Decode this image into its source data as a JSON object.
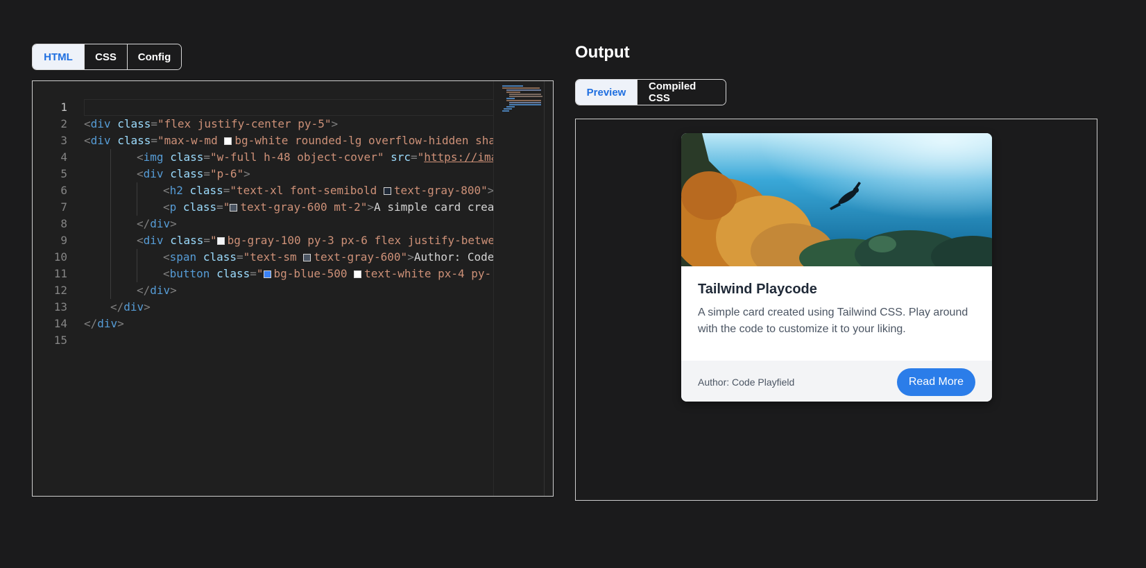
{
  "editor": {
    "tabs": [
      {
        "label": "HTML",
        "active": true
      },
      {
        "label": "CSS",
        "active": false
      },
      {
        "label": "Config",
        "active": false
      }
    ],
    "line_numbers": [
      "1",
      "2",
      "3",
      "4",
      "5",
      "6",
      "7",
      "8",
      "9",
      "10",
      "11",
      "12",
      "13",
      "14",
      "15"
    ],
    "lines": [
      {
        "indent": 0,
        "tokens": []
      },
      {
        "indent": 0,
        "tokens": [
          {
            "t": "punc",
            "v": "<"
          },
          {
            "t": "tag",
            "v": "div"
          },
          {
            "t": "text",
            "v": " "
          },
          {
            "t": "attr",
            "v": "class"
          },
          {
            "t": "punc",
            "v": "="
          },
          {
            "t": "str",
            "v": "\"flex justify-center py-5\""
          },
          {
            "t": "punc",
            "v": ">"
          }
        ]
      },
      {
        "indent": 0,
        "tokens": [
          {
            "t": "punc",
            "v": "<"
          },
          {
            "t": "tag",
            "v": "div"
          },
          {
            "t": "text",
            "v": " "
          },
          {
            "t": "attr",
            "v": "class"
          },
          {
            "t": "punc",
            "v": "="
          },
          {
            "t": "str",
            "v": "\"max-w-md "
          },
          {
            "t": "swatch",
            "v": "#ffffff"
          },
          {
            "t": "str",
            "v": "bg-white rounded-lg overflow-hidden sha"
          }
        ]
      },
      {
        "indent": 2,
        "tokens": [
          {
            "t": "punc",
            "v": "<"
          },
          {
            "t": "tag",
            "v": "img"
          },
          {
            "t": "text",
            "v": " "
          },
          {
            "t": "attr",
            "v": "class"
          },
          {
            "t": "punc",
            "v": "="
          },
          {
            "t": "str",
            "v": "\"w-full h-48 object-cover\""
          },
          {
            "t": "text",
            "v": " "
          },
          {
            "t": "attr",
            "v": "src"
          },
          {
            "t": "punc",
            "v": "="
          },
          {
            "t": "str",
            "v": "\""
          },
          {
            "t": "url",
            "v": "https://ima"
          }
        ]
      },
      {
        "indent": 2,
        "tokens": [
          {
            "t": "punc",
            "v": "<"
          },
          {
            "t": "tag",
            "v": "div"
          },
          {
            "t": "text",
            "v": " "
          },
          {
            "t": "attr",
            "v": "class"
          },
          {
            "t": "punc",
            "v": "="
          },
          {
            "t": "str",
            "v": "\"p-6\""
          },
          {
            "t": "punc",
            "v": ">"
          }
        ]
      },
      {
        "indent": 3,
        "tokens": [
          {
            "t": "punc",
            "v": "<"
          },
          {
            "t": "tag",
            "v": "h2"
          },
          {
            "t": "text",
            "v": " "
          },
          {
            "t": "attr",
            "v": "class"
          },
          {
            "t": "punc",
            "v": "="
          },
          {
            "t": "str",
            "v": "\"text-xl font-semibold "
          },
          {
            "t": "swatch",
            "v": "#1f2937"
          },
          {
            "t": "str",
            "v": "text-gray-800\""
          },
          {
            "t": "punc",
            "v": ">"
          }
        ]
      },
      {
        "indent": 3,
        "tokens": [
          {
            "t": "punc",
            "v": "<"
          },
          {
            "t": "tag",
            "v": "p"
          },
          {
            "t": "text",
            "v": " "
          },
          {
            "t": "attr",
            "v": "class"
          },
          {
            "t": "punc",
            "v": "="
          },
          {
            "t": "str",
            "v": "\""
          },
          {
            "t": "swatch",
            "v": "#4b5563"
          },
          {
            "t": "str",
            "v": "text-gray-600 mt-2\""
          },
          {
            "t": "punc",
            "v": ">"
          },
          {
            "t": "text",
            "v": "A simple card crea"
          }
        ]
      },
      {
        "indent": 2,
        "tokens": [
          {
            "t": "punc",
            "v": "</"
          },
          {
            "t": "tag",
            "v": "div"
          },
          {
            "t": "punc",
            "v": ">"
          }
        ]
      },
      {
        "indent": 2,
        "tokens": [
          {
            "t": "punc",
            "v": "<"
          },
          {
            "t": "tag",
            "v": "div"
          },
          {
            "t": "text",
            "v": " "
          },
          {
            "t": "attr",
            "v": "class"
          },
          {
            "t": "punc",
            "v": "="
          },
          {
            "t": "str",
            "v": "\""
          },
          {
            "t": "swatch",
            "v": "#f3f4f6"
          },
          {
            "t": "str",
            "v": "bg-gray-100 py-3 px-6 flex justify-betwe"
          }
        ]
      },
      {
        "indent": 3,
        "tokens": [
          {
            "t": "punc",
            "v": "<"
          },
          {
            "t": "tag",
            "v": "span"
          },
          {
            "t": "text",
            "v": " "
          },
          {
            "t": "attr",
            "v": "class"
          },
          {
            "t": "punc",
            "v": "="
          },
          {
            "t": "str",
            "v": "\"text-sm "
          },
          {
            "t": "swatch",
            "v": "#4b5563"
          },
          {
            "t": "str",
            "v": "text-gray-600\""
          },
          {
            "t": "punc",
            "v": ">"
          },
          {
            "t": "text",
            "v": "Author: Code"
          }
        ]
      },
      {
        "indent": 3,
        "tokens": [
          {
            "t": "punc",
            "v": "<"
          },
          {
            "t": "tag",
            "v": "button"
          },
          {
            "t": "text",
            "v": " "
          },
          {
            "t": "attr",
            "v": "class"
          },
          {
            "t": "punc",
            "v": "="
          },
          {
            "t": "str",
            "v": "\""
          },
          {
            "t": "swatch",
            "v": "#3b82f6"
          },
          {
            "t": "str",
            "v": "bg-blue-500 "
          },
          {
            "t": "swatch",
            "v": "#ffffff"
          },
          {
            "t": "str",
            "v": "text-white px-4 py-"
          }
        ]
      },
      {
        "indent": 2,
        "tokens": [
          {
            "t": "punc",
            "v": "</"
          },
          {
            "t": "tag",
            "v": "div"
          },
          {
            "t": "punc",
            "v": ">"
          }
        ]
      },
      {
        "indent": 1,
        "tokens": [
          {
            "t": "punc",
            "v": "</"
          },
          {
            "t": "tag",
            "v": "div"
          },
          {
            "t": "punc",
            "v": ">"
          }
        ]
      },
      {
        "indent": 0,
        "tokens": [
          {
            "t": "punc",
            "v": "</"
          },
          {
            "t": "tag",
            "v": "div"
          },
          {
            "t": "punc",
            "v": ">"
          }
        ]
      },
      {
        "indent": 0,
        "tokens": []
      }
    ]
  },
  "output": {
    "title": "Output",
    "tabs": [
      {
        "label": "Preview",
        "active": true
      },
      {
        "label": "Compiled CSS",
        "active": false
      }
    ],
    "card": {
      "title": "Tailwind Playcode",
      "text": "A simple card created using Tailwind CSS. Play around with the code to customize it to your liking.",
      "author": "Author: Code Playfield",
      "button_label": "Read More"
    }
  },
  "colors": {
    "background": "#1b1b1c",
    "accent": "#1f6fe0",
    "button": "#2b7de9"
  }
}
